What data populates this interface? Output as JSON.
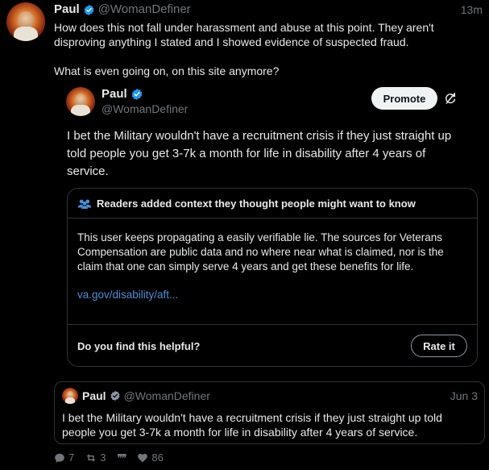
{
  "post": {
    "author_name": "Paul",
    "author_handle": "@WomanDefiner",
    "time": "13m",
    "text_line1": "How does this not fall under harassment and abuse at this point. They aren't",
    "text_line2": "disproving anything I stated and I showed evidence of suspected fraud.",
    "text_line3": "What is even going on, on this site anymore?"
  },
  "quoted_post": {
    "author_name": "Paul",
    "author_handle": "@WomanDefiner",
    "promote_label": "Promote",
    "text_line1": "I bet the Military wouldn't have a recruitment crisis if they just straight up",
    "text_line2": "told people you get 3-7k a month for life in disability after 4 years of",
    "text_line3": "service."
  },
  "community_note": {
    "header": "Readers added context they thought people might want to know",
    "body_line1": "This user keeps propagating a easily verifiable lie. The sources for Veterans",
    "body_line2": "Compensation are public data and no where near what is claimed, nor is the",
    "body_line3": "claim that one can simply serve 4 years and get these benefits for life.",
    "link": "va.gov/disability/aft...",
    "helpful_prompt": "Do you find this helpful?",
    "rate_label": "Rate it"
  },
  "embedded_quote": {
    "author_name": "Paul",
    "author_handle": "@WomanDefiner",
    "date": "Jun 3",
    "text_line1": "I bet the Military wouldn't have a recruitment crisis if they just straight up told",
    "text_line2": "people you get 3-7k a month for life in disability after 4 years of service."
  },
  "actions": {
    "replies": "7",
    "reposts": "3",
    "quote_glyph": "❞❞",
    "likes": "86"
  },
  "colors": {
    "background": "#000000",
    "text": "#e7e9ea",
    "muted": "#71767b",
    "verified": "#1d9bf0",
    "link": "#4e8fd6"
  },
  "icons": [
    "verified-badge-icon",
    "refresh-icon",
    "people-icon",
    "reply-icon",
    "repost-icon",
    "quote-icon",
    "heart-icon"
  ]
}
